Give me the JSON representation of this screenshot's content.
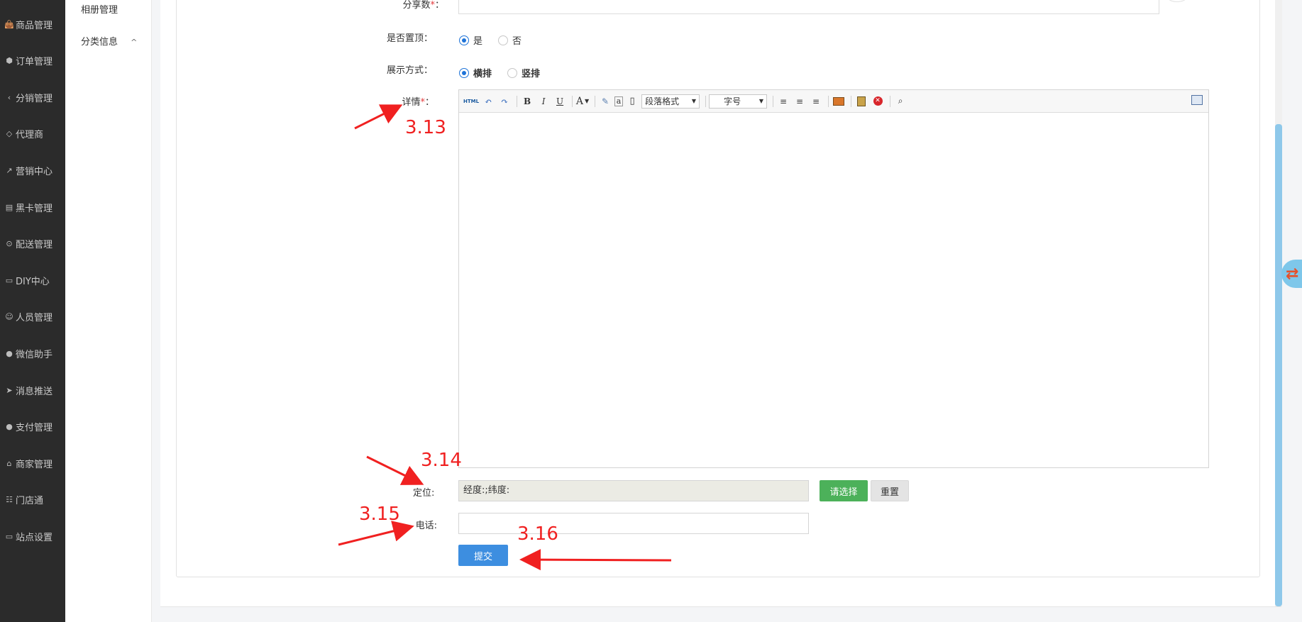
{
  "sidebar": {
    "items": [
      {
        "label": "商品管理",
        "icon": "bag-icon"
      },
      {
        "label": "订单管理",
        "icon": "cube-icon"
      },
      {
        "label": "分销管理",
        "icon": "share-icon"
      },
      {
        "label": "代理商",
        "icon": "diamond-icon"
      },
      {
        "label": "营销中心",
        "icon": "line-chart-icon"
      },
      {
        "label": "黑卡管理",
        "icon": "id-card-icon"
      },
      {
        "label": "配送管理",
        "icon": "motorcycle-icon"
      },
      {
        "label": "DIY中心",
        "icon": "monitor-icon"
      },
      {
        "label": "人员管理",
        "icon": "users-icon"
      },
      {
        "label": "微信助手",
        "icon": "wechat-icon"
      },
      {
        "label": "消息推送",
        "icon": "send-icon"
      },
      {
        "label": "支付管理",
        "icon": "wechat-icon"
      },
      {
        "label": "商家管理",
        "icon": "bank-icon"
      },
      {
        "label": "门店通",
        "icon": "grid-icon"
      },
      {
        "label": "站点设置",
        "icon": "monitor-icon"
      }
    ]
  },
  "submenu": {
    "album": "相册管理",
    "category": "分类信息"
  },
  "form": {
    "share_label": "分享数",
    "top_label": "是否置顶：",
    "top_yes": "是",
    "top_no": "否",
    "display_label": "展示方式：",
    "display_horizontal": "横排",
    "display_vertical": "竖排",
    "detail_label": "详情",
    "required_mark": "*",
    "colon": "：",
    "location_label": "定位:",
    "location_value": "经度:;纬度:",
    "choose_button": "请选择",
    "reset_button": "重置",
    "phone_label": "电话:",
    "submit_button": "提交"
  },
  "editor": {
    "html_btn": "HTML",
    "bold": "B",
    "italic": "I",
    "underline": "U",
    "font_color": "A",
    "paragraph_select": "段落格式",
    "fontsize_select": "字号"
  },
  "annotations": {
    "a1": "3.13",
    "a2": "3.14",
    "a3": "3.15",
    "a4": "3.16"
  },
  "colors": {
    "sidebar_bg": "#2b2b2b",
    "accent_blue": "#3d8ee0",
    "green": "#4cb15a",
    "annotation_red": "#f02020"
  }
}
